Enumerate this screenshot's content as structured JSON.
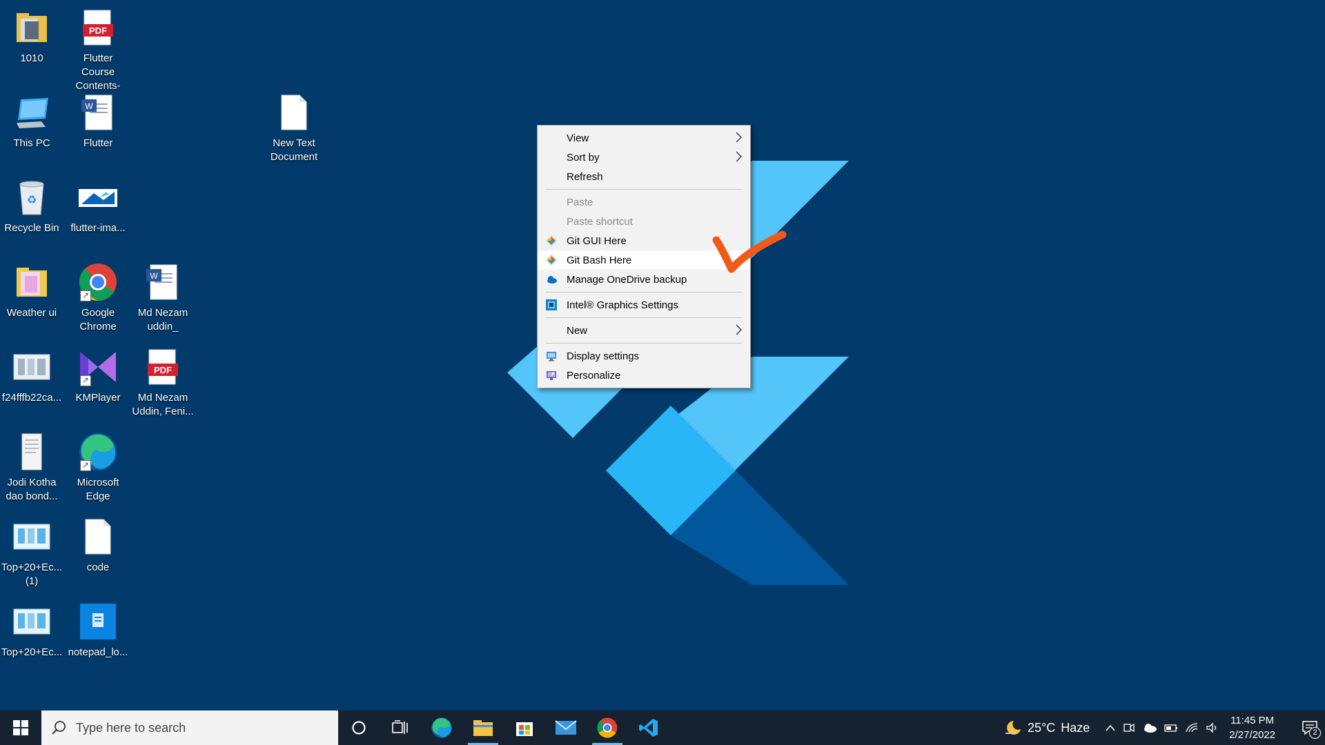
{
  "desktop": {
    "icons": [
      {
        "label": "1010",
        "icon": "folder-icon"
      },
      {
        "label": "Flutter Course Contents- N...",
        "icon": "pdf-icon"
      },
      {
        "label": "This PC",
        "icon": "this-pc-icon"
      },
      {
        "label": "Flutter",
        "icon": "word-doc-icon"
      },
      {
        "label": "New Text Document",
        "icon": "text-file-icon"
      },
      {
        "label": "Recycle Bin",
        "icon": "recycle-bin-icon"
      },
      {
        "label": "flutter-ima...",
        "icon": "image-file-icon"
      },
      {
        "label": "Weather ui",
        "icon": "folder-icon"
      },
      {
        "label": "Google Chrome",
        "icon": "chrome-icon"
      },
      {
        "label": "Md Nezam uddin_",
        "icon": "word-doc-icon"
      },
      {
        "label": "f24fffb22ca...",
        "icon": "image-file-icon"
      },
      {
        "label": "KMPlayer",
        "icon": "kmplayer-icon"
      },
      {
        "label": "Md Nezam Uddin, Feni...",
        "icon": "pdf-icon"
      },
      {
        "label": "Jodi Kotha dao bond...",
        "icon": "document-icon"
      },
      {
        "label": "Microsoft Edge",
        "icon": "edge-icon"
      },
      {
        "label": "Top+20+Ec... (1)",
        "icon": "image-file-icon"
      },
      {
        "label": "code",
        "icon": "text-file-icon"
      },
      {
        "label": "Top+20+Ec...",
        "icon": "image-file-icon"
      },
      {
        "label": "notepad_lo...",
        "icon": "notepad-icon"
      }
    ]
  },
  "pdf_badge": "PDF",
  "context_menu": {
    "view": "View",
    "sort_by": "Sort by",
    "refresh": "Refresh",
    "paste": "Paste",
    "paste_shortcut": "Paste shortcut",
    "git_gui": "Git GUI Here",
    "git_bash": "Git Bash Here",
    "onedrive": "Manage OneDrive backup",
    "intel_graphics": "Intel® Graphics Settings",
    "new": "New",
    "display_settings": "Display settings",
    "personalize": "Personalize"
  },
  "taskbar": {
    "search_placeholder": "Type here to search",
    "pinned": [
      "windows-start-icon",
      "cortana-icon",
      "task-view-icon",
      "edge-icon",
      "file-explorer-icon",
      "store-icon",
      "mail-icon",
      "chrome-icon",
      "vscode-icon"
    ],
    "weather_temp": "25°C",
    "weather_desc": "Haze",
    "time": "11:45 PM",
    "date": "2/27/2022",
    "notification_count": "2"
  },
  "colors": {
    "desktop_bg": "#013a6b",
    "flutter_light": "#54c5f8",
    "flutter_mid": "#29b6f6",
    "flutter_dark": "#01579b",
    "annotation": "#f05a19",
    "taskbar_bg": "#16222f"
  }
}
